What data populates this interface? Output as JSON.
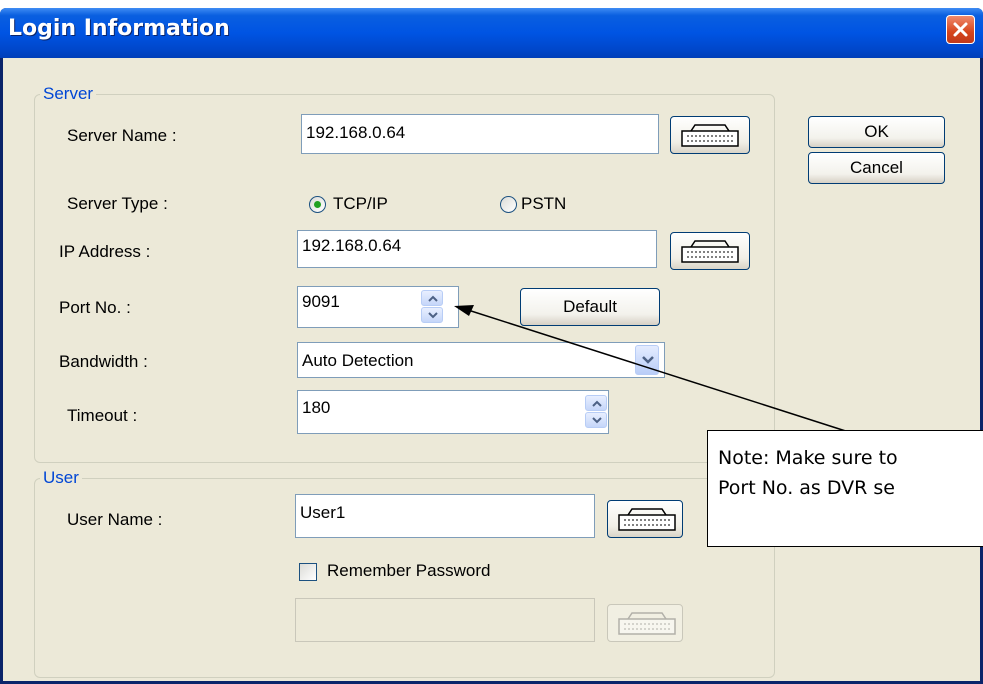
{
  "window": {
    "title": "Login Information"
  },
  "buttons": {
    "ok": "OK",
    "cancel": "Cancel",
    "default": "Default"
  },
  "server": {
    "legend": "Server",
    "server_name_label": "Server Name :",
    "server_name_value": "192.168.0.64",
    "server_type_label": "Server Type :",
    "server_type_options": [
      "TCP/IP",
      "PSTN"
    ],
    "server_type_selected": "TCP/IP",
    "ip_address_label": "IP Address :",
    "ip_address_value": "192.168.0.64",
    "port_label": "Port No. :",
    "port_value": "9091",
    "bandwidth_label": "Bandwidth :",
    "bandwidth_value": "Auto Detection",
    "timeout_label": "Timeout :",
    "timeout_value": "180"
  },
  "user": {
    "legend": "User",
    "user_name_label": "User Name :",
    "user_name_value": "User1",
    "remember_password_label": "Remember Password",
    "remember_password_checked": false,
    "password_value": ""
  },
  "note": {
    "line1": "Note: Make sure to",
    "line2": "Port No. as DVR se"
  },
  "colors": {
    "titlebar": "#0054e3",
    "dialog_bg": "#ece9d8",
    "legend_text": "#0046d5",
    "radio_dot": "#21a121",
    "close_button": "#d6451c"
  },
  "icons": {
    "keyboard": "keyboard-icon",
    "close": "close-icon",
    "spin_up": "spin-up-icon",
    "spin_down": "spin-down-icon",
    "dropdown": "chevron-down-icon"
  }
}
